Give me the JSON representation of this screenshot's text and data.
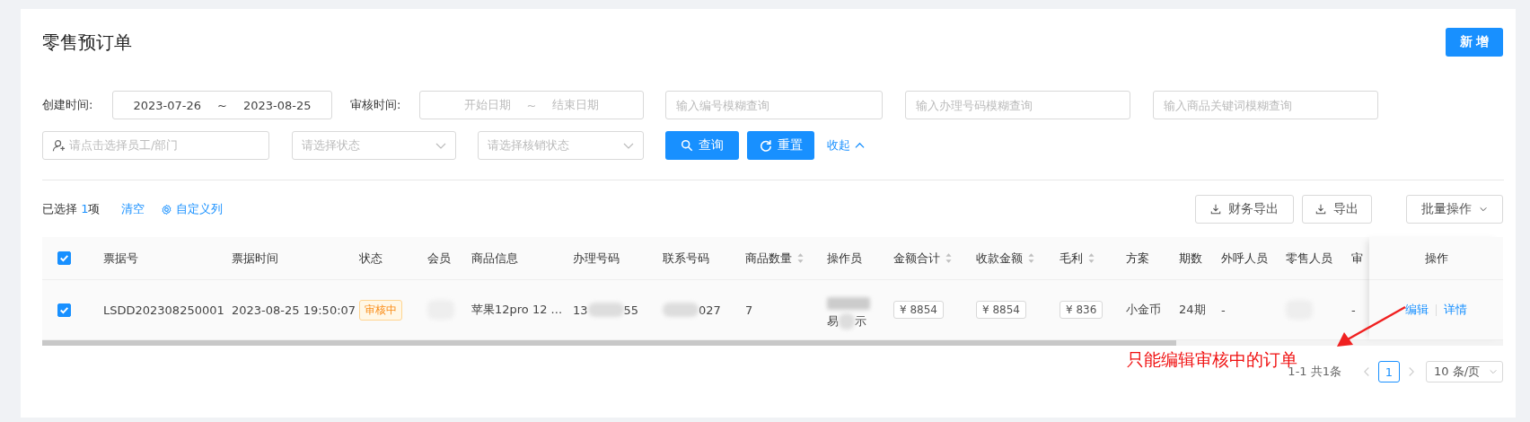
{
  "page_title": "零售预订单",
  "add_button": "新 增",
  "filters": {
    "created_label": "创建时间:",
    "created_start": "2023-07-26",
    "created_sep": "~",
    "created_end": "2023-08-25",
    "audit_label": "审核时间:",
    "audit_start_placeholder": "开始日期",
    "audit_sep": "~",
    "audit_end_placeholder": "结束日期",
    "code_placeholder": "输入编号模糊查询",
    "handle_placeholder": "输入办理号码模糊查询",
    "keyword_placeholder": "输入商品关键词模糊查询",
    "staff_placeholder": "请点击选择员工/部门",
    "status_placeholder": "请选择状态",
    "writeoff_placeholder": "请选择核销状态",
    "query_button": "查询",
    "reset_button": "重置",
    "collapse_link": "收起"
  },
  "toolbar": {
    "selected_prefix": "已选择",
    "selected_count": "1",
    "selected_suffix": "项",
    "clear_link": "清空",
    "columns_link": "自定义列",
    "buttons": [
      "财务导出",
      "导出"
    ],
    "batch_button": "批量操作"
  },
  "table": {
    "header_checked": true,
    "columns": [
      {
        "label": "票据号",
        "kind": "plain"
      },
      {
        "label": "票据时间",
        "kind": "plain"
      },
      {
        "label": "状态",
        "kind": "plain"
      },
      {
        "label": "会员",
        "kind": "plain"
      },
      {
        "label": "商品信息",
        "kind": "plain"
      },
      {
        "label": "办理号码",
        "kind": "plain"
      },
      {
        "label": "联系号码",
        "kind": "plain"
      },
      {
        "label": "商品数量",
        "kind": "sortable"
      },
      {
        "label": "操作员",
        "kind": "plain"
      },
      {
        "label": "金额合计",
        "kind": "sortable"
      },
      {
        "label": "收款金额",
        "kind": "sortable"
      },
      {
        "label": "毛利",
        "kind": "sortable"
      },
      {
        "label": "方案",
        "kind": "plain"
      },
      {
        "label": "期数",
        "kind": "plain"
      },
      {
        "label": "外呼人员",
        "kind": "plain"
      },
      {
        "label": "零售人员",
        "kind": "plain"
      },
      {
        "label": "审",
        "kind": "plain"
      }
    ],
    "actions_header": "操作",
    "rows": [
      {
        "checked": true,
        "cells": [
          {
            "kind": "text",
            "text": "LSDD202308250001"
          },
          {
            "kind": "text",
            "text": "2023-08-25 19:50:07"
          },
          {
            "kind": "tag",
            "text": "审核中"
          },
          {
            "kind": "blurred"
          },
          {
            "kind": "text",
            "text": "苹果12pro 12 ..."
          },
          {
            "kind": "partial",
            "prefix": "13",
            "suffix": "55"
          },
          {
            "kind": "partial",
            "suffix": "027"
          },
          {
            "kind": "text",
            "text": "7"
          },
          {
            "kind": "stacked",
            "prefix": "易",
            "suffix": "示"
          },
          {
            "kind": "amount",
            "text": "¥ 8854"
          },
          {
            "kind": "amount",
            "text": "¥ 8854"
          },
          {
            "kind": "amount",
            "text": "¥ 836"
          },
          {
            "kind": "text",
            "text": "小金币"
          },
          {
            "kind": "text",
            "text": "24期"
          },
          {
            "kind": "text",
            "text": "-"
          },
          {
            "kind": "blurred"
          },
          {
            "kind": "text",
            "text": "-"
          }
        ],
        "actions": [
          "编辑",
          "详情"
        ]
      }
    ]
  },
  "pagination": {
    "summary": "1-1 共1条",
    "pages": [
      {
        "label": "1",
        "selected": true
      }
    ],
    "page_size": "10 条/页"
  },
  "annotation": "只能编辑审核中的订单"
}
